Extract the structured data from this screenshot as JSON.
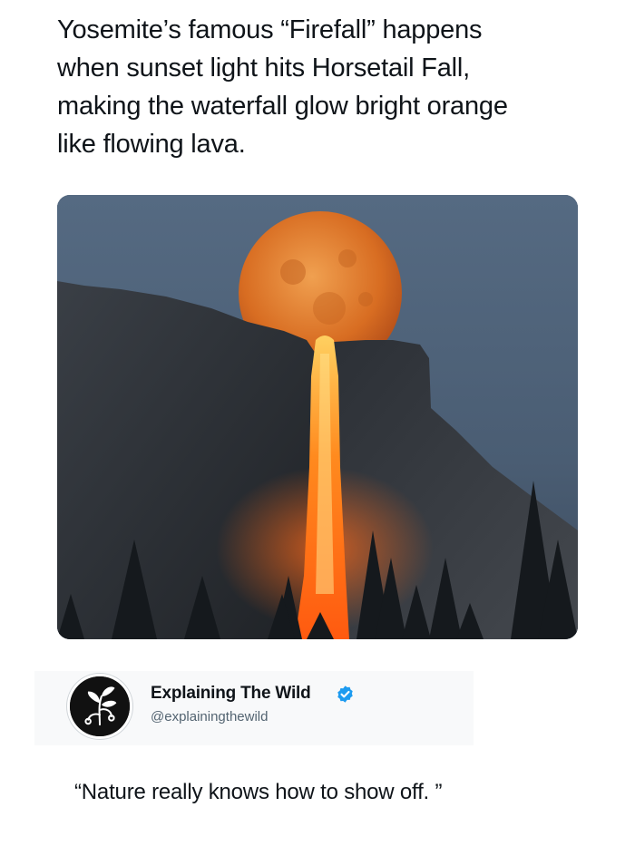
{
  "post": {
    "text_lines": [
      "Yosemite’s famous “Firefall” happens",
      "when sunset light hits Horsetail Fall,",
      "making the waterfall glow bright orange",
      "like flowing lava."
    ]
  },
  "media": {
    "subject": "waterfall-photo",
    "colors": {
      "sky": "#4a5d73",
      "moon": "#e07a2a",
      "lava": "#ff7a1a",
      "rock": "#2a2e33"
    }
  },
  "quoted_account": {
    "name": "Explaining The Wild",
    "handle": "@explainingthewild",
    "verified_color": "#1d9bf0"
  },
  "caption": "“Nature really knows how to show off. ”"
}
